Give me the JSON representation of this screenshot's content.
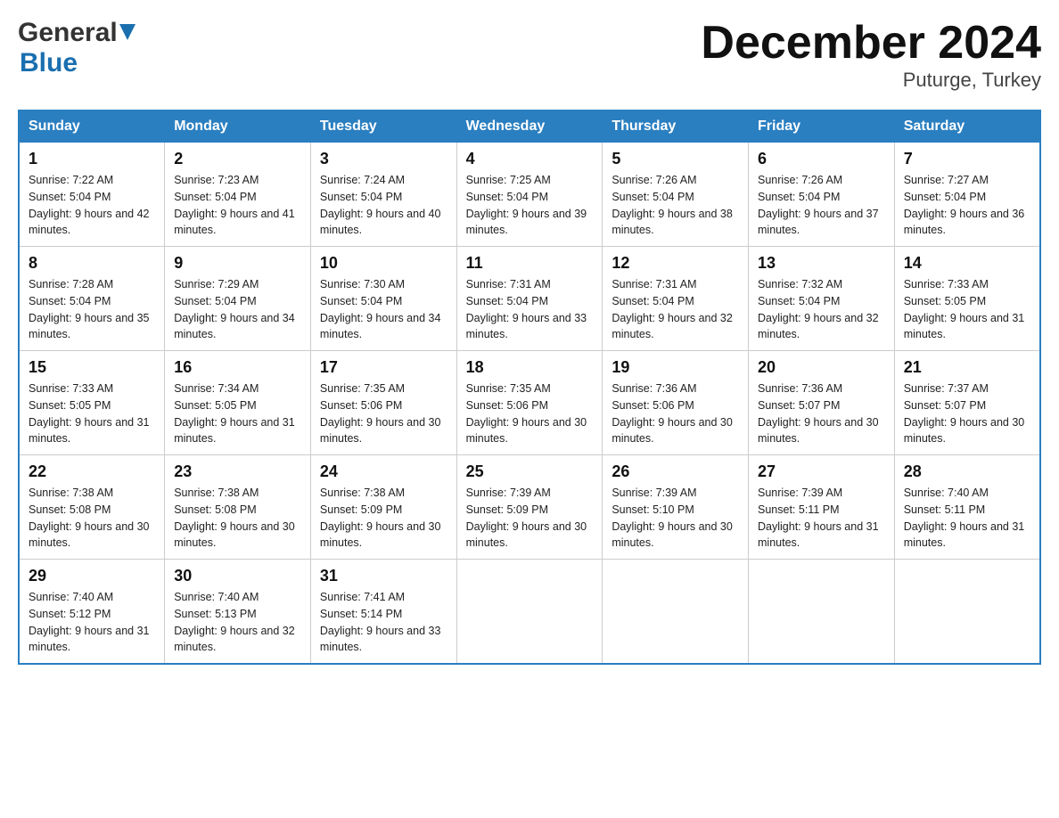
{
  "header": {
    "logo_general": "General",
    "logo_blue": "Blue",
    "month_title": "December 2024",
    "location": "Puturge, Turkey"
  },
  "days_of_week": [
    "Sunday",
    "Monday",
    "Tuesday",
    "Wednesday",
    "Thursday",
    "Friday",
    "Saturday"
  ],
  "weeks": [
    [
      {
        "day": "1",
        "sunrise": "7:22 AM",
        "sunset": "5:04 PM",
        "daylight": "9 hours and 42 minutes."
      },
      {
        "day": "2",
        "sunrise": "7:23 AM",
        "sunset": "5:04 PM",
        "daylight": "9 hours and 41 minutes."
      },
      {
        "day": "3",
        "sunrise": "7:24 AM",
        "sunset": "5:04 PM",
        "daylight": "9 hours and 40 minutes."
      },
      {
        "day": "4",
        "sunrise": "7:25 AM",
        "sunset": "5:04 PM",
        "daylight": "9 hours and 39 minutes."
      },
      {
        "day": "5",
        "sunrise": "7:26 AM",
        "sunset": "5:04 PM",
        "daylight": "9 hours and 38 minutes."
      },
      {
        "day": "6",
        "sunrise": "7:26 AM",
        "sunset": "5:04 PM",
        "daylight": "9 hours and 37 minutes."
      },
      {
        "day": "7",
        "sunrise": "7:27 AM",
        "sunset": "5:04 PM",
        "daylight": "9 hours and 36 minutes."
      }
    ],
    [
      {
        "day": "8",
        "sunrise": "7:28 AM",
        "sunset": "5:04 PM",
        "daylight": "9 hours and 35 minutes."
      },
      {
        "day": "9",
        "sunrise": "7:29 AM",
        "sunset": "5:04 PM",
        "daylight": "9 hours and 34 minutes."
      },
      {
        "day": "10",
        "sunrise": "7:30 AM",
        "sunset": "5:04 PM",
        "daylight": "9 hours and 34 minutes."
      },
      {
        "day": "11",
        "sunrise": "7:31 AM",
        "sunset": "5:04 PM",
        "daylight": "9 hours and 33 minutes."
      },
      {
        "day": "12",
        "sunrise": "7:31 AM",
        "sunset": "5:04 PM",
        "daylight": "9 hours and 32 minutes."
      },
      {
        "day": "13",
        "sunrise": "7:32 AM",
        "sunset": "5:04 PM",
        "daylight": "9 hours and 32 minutes."
      },
      {
        "day": "14",
        "sunrise": "7:33 AM",
        "sunset": "5:05 PM",
        "daylight": "9 hours and 31 minutes."
      }
    ],
    [
      {
        "day": "15",
        "sunrise": "7:33 AM",
        "sunset": "5:05 PM",
        "daylight": "9 hours and 31 minutes."
      },
      {
        "day": "16",
        "sunrise": "7:34 AM",
        "sunset": "5:05 PM",
        "daylight": "9 hours and 31 minutes."
      },
      {
        "day": "17",
        "sunrise": "7:35 AM",
        "sunset": "5:06 PM",
        "daylight": "9 hours and 30 minutes."
      },
      {
        "day": "18",
        "sunrise": "7:35 AM",
        "sunset": "5:06 PM",
        "daylight": "9 hours and 30 minutes."
      },
      {
        "day": "19",
        "sunrise": "7:36 AM",
        "sunset": "5:06 PM",
        "daylight": "9 hours and 30 minutes."
      },
      {
        "day": "20",
        "sunrise": "7:36 AM",
        "sunset": "5:07 PM",
        "daylight": "9 hours and 30 minutes."
      },
      {
        "day": "21",
        "sunrise": "7:37 AM",
        "sunset": "5:07 PM",
        "daylight": "9 hours and 30 minutes."
      }
    ],
    [
      {
        "day": "22",
        "sunrise": "7:38 AM",
        "sunset": "5:08 PM",
        "daylight": "9 hours and 30 minutes."
      },
      {
        "day": "23",
        "sunrise": "7:38 AM",
        "sunset": "5:08 PM",
        "daylight": "9 hours and 30 minutes."
      },
      {
        "day": "24",
        "sunrise": "7:38 AM",
        "sunset": "5:09 PM",
        "daylight": "9 hours and 30 minutes."
      },
      {
        "day": "25",
        "sunrise": "7:39 AM",
        "sunset": "5:09 PM",
        "daylight": "9 hours and 30 minutes."
      },
      {
        "day": "26",
        "sunrise": "7:39 AM",
        "sunset": "5:10 PM",
        "daylight": "9 hours and 30 minutes."
      },
      {
        "day": "27",
        "sunrise": "7:39 AM",
        "sunset": "5:11 PM",
        "daylight": "9 hours and 31 minutes."
      },
      {
        "day": "28",
        "sunrise": "7:40 AM",
        "sunset": "5:11 PM",
        "daylight": "9 hours and 31 minutes."
      }
    ],
    [
      {
        "day": "29",
        "sunrise": "7:40 AM",
        "sunset": "5:12 PM",
        "daylight": "9 hours and 31 minutes."
      },
      {
        "day": "30",
        "sunrise": "7:40 AM",
        "sunset": "5:13 PM",
        "daylight": "9 hours and 32 minutes."
      },
      {
        "day": "31",
        "sunrise": "7:41 AM",
        "sunset": "5:14 PM",
        "daylight": "9 hours and 33 minutes."
      },
      null,
      null,
      null,
      null
    ]
  ],
  "labels": {
    "sunrise": "Sunrise: ",
    "sunset": "Sunset: ",
    "daylight": "Daylight: "
  }
}
